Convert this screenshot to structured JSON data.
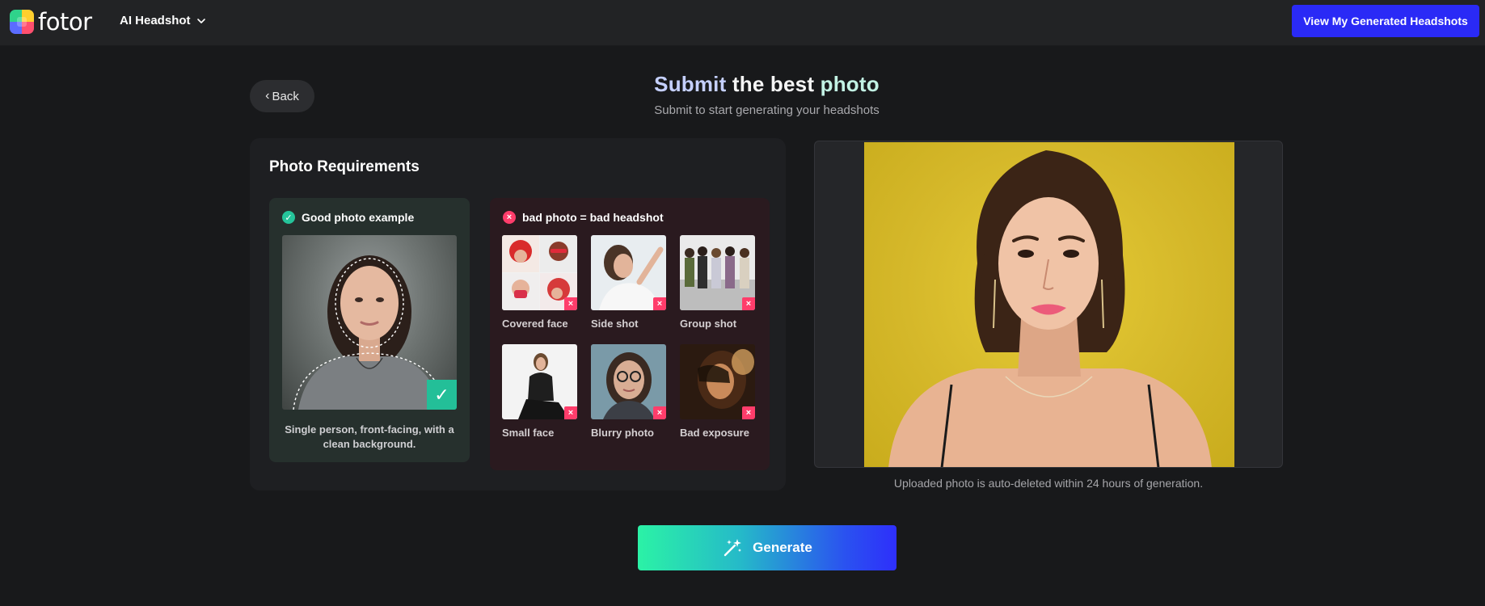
{
  "header": {
    "logo_text": "fotor",
    "product_label": "AI Headshot",
    "view_button_label": "View My Generated Headshots"
  },
  "back_label": "Back",
  "title": {
    "word1": "Submit",
    "word2": "the best",
    "word3": "photo",
    "subtitle": "Submit to start generating your headshots"
  },
  "requirements": {
    "title": "Photo Requirements",
    "good": {
      "heading": "Good photo example",
      "caption": "Single person, front-facing, with a clean background."
    },
    "bad": {
      "heading": "bad photo = bad headshot",
      "items": [
        {
          "label": "Covered face"
        },
        {
          "label": "Side shot"
        },
        {
          "label": "Group shot"
        },
        {
          "label": "Small face"
        },
        {
          "label": "Blurry photo"
        },
        {
          "label": "Bad exposure"
        }
      ]
    }
  },
  "preview": {
    "note": "Uploaded photo is auto-deleted within 24 hours of generation."
  },
  "generate_label": "Generate",
  "colors": {
    "accent_blue": "#2a2af6",
    "good_green": "#25c49a",
    "bad_red": "#ff3d6b",
    "background": "#18191b"
  }
}
